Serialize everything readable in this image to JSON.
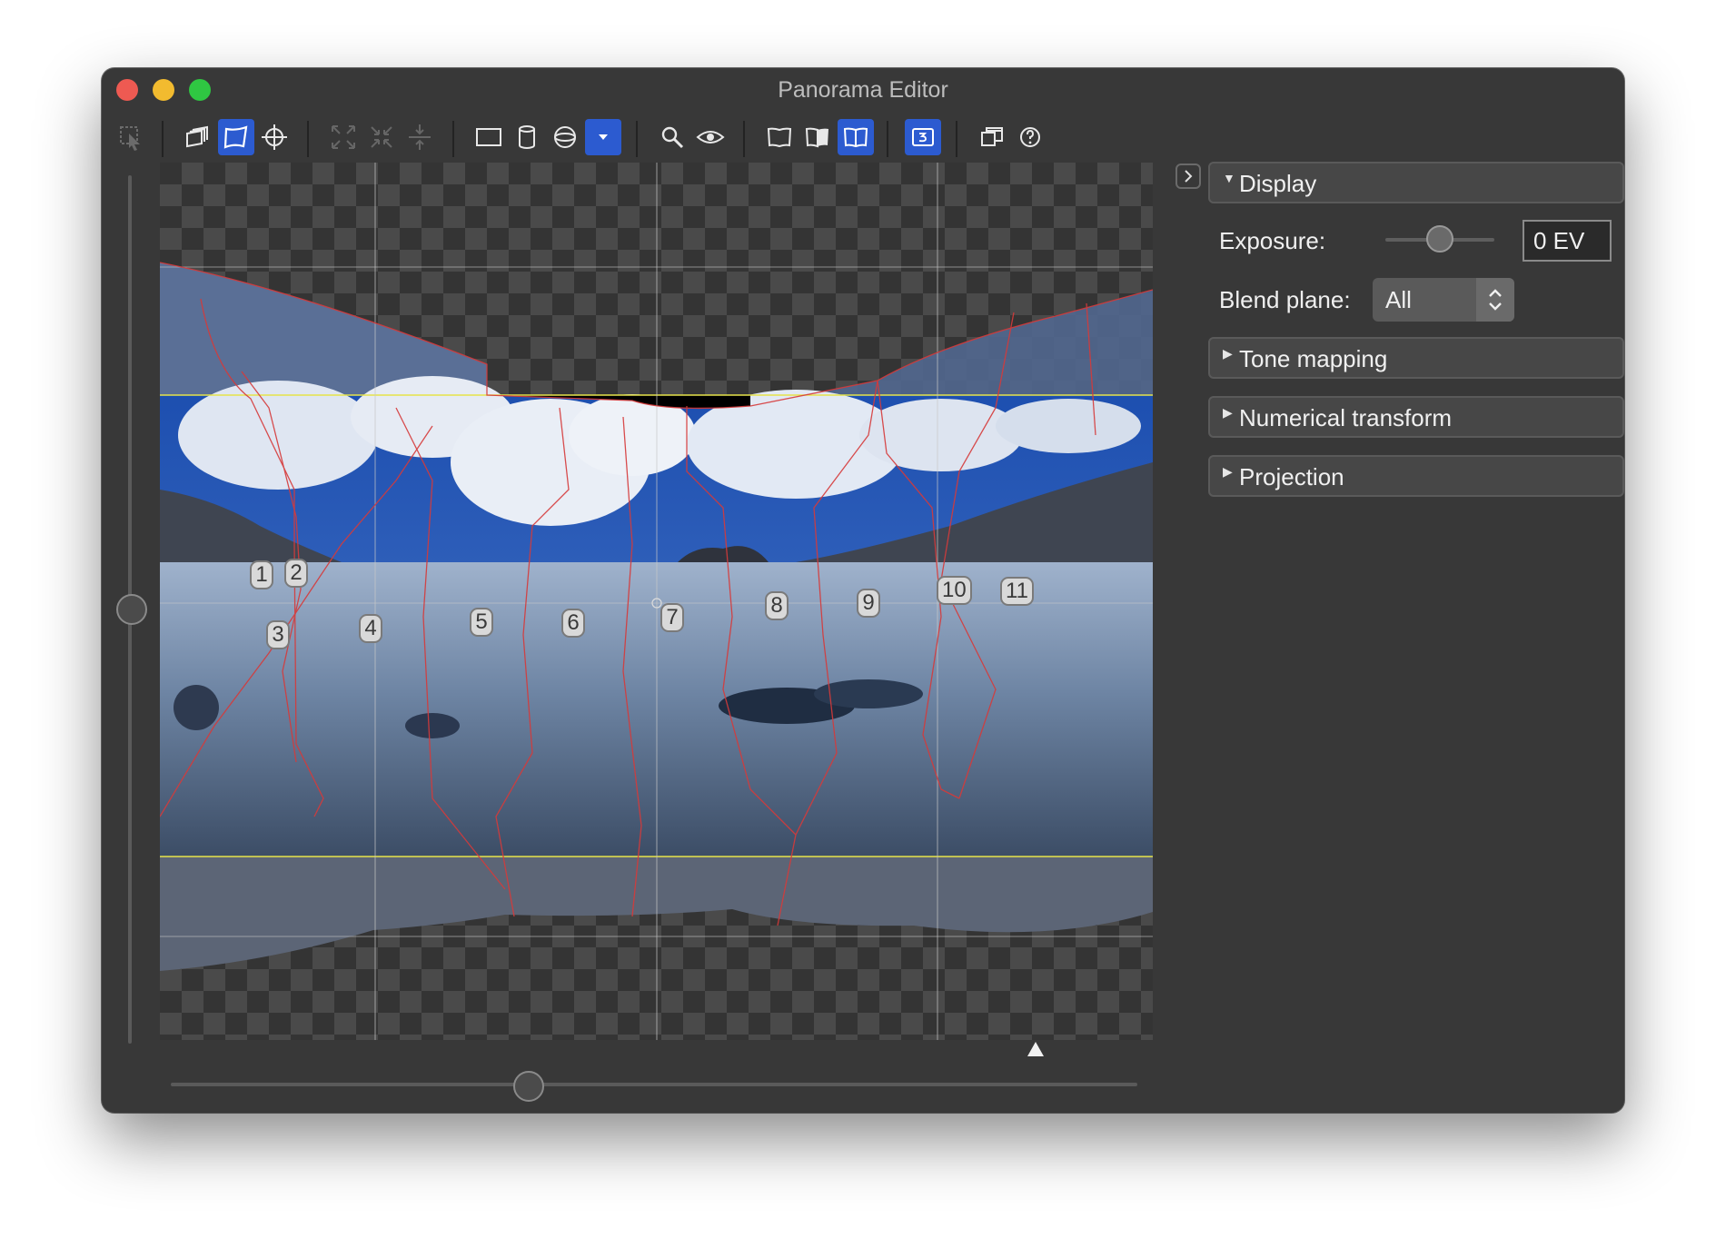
{
  "window": {
    "title": "Panorama Editor"
  },
  "toolbar": {
    "tools": [
      {
        "name": "select-tool-icon",
        "active": false
      },
      {
        "name": "layers-tool-icon",
        "active": false
      },
      {
        "name": "warp-tool-icon",
        "active": true
      },
      {
        "name": "crosshair-tool-icon",
        "active": false
      },
      {
        "name": "expand-icon",
        "active": false
      },
      {
        "name": "collapse-icon",
        "active": false
      },
      {
        "name": "align-icon",
        "active": false
      },
      {
        "name": "rectilinear-projection-icon",
        "active": false
      },
      {
        "name": "cylindrical-projection-icon",
        "active": false
      },
      {
        "name": "spherical-projection-icon",
        "active": false
      },
      {
        "name": "projection-dropdown-icon",
        "active": true
      },
      {
        "name": "zoom-icon",
        "active": false
      },
      {
        "name": "eye-icon",
        "active": false
      },
      {
        "name": "book-left-icon",
        "active": false
      },
      {
        "name": "book-middle-icon",
        "active": false
      },
      {
        "name": "book-spread-icon",
        "active": true
      },
      {
        "name": "frame-number-icon",
        "active": true
      },
      {
        "name": "windows-icon",
        "active": false
      },
      {
        "name": "help-icon",
        "active": false
      }
    ]
  },
  "canvas": {
    "image_labels": [
      "1",
      "2",
      "3",
      "4",
      "5",
      "6",
      "7",
      "8",
      "9",
      "10",
      "11"
    ]
  },
  "sidebar": {
    "display": {
      "title": "Display",
      "expanded": true,
      "exposure_label": "Exposure:",
      "exposure_value": "0 EV",
      "exposure_slider": 0.5,
      "blend_plane_label": "Blend plane:",
      "blend_plane_value": "All"
    },
    "sections": [
      {
        "title": "Tone mapping",
        "expanded": false
      },
      {
        "title": "Numerical transform",
        "expanded": false
      },
      {
        "title": "Projection",
        "expanded": false
      }
    ]
  },
  "sliders": {
    "horizontal": 0.37,
    "vertical": 0.5
  },
  "colors": {
    "accent": "#2c5bd0",
    "seam": "#d63a3a",
    "crop_guide": "#e6e34a"
  }
}
